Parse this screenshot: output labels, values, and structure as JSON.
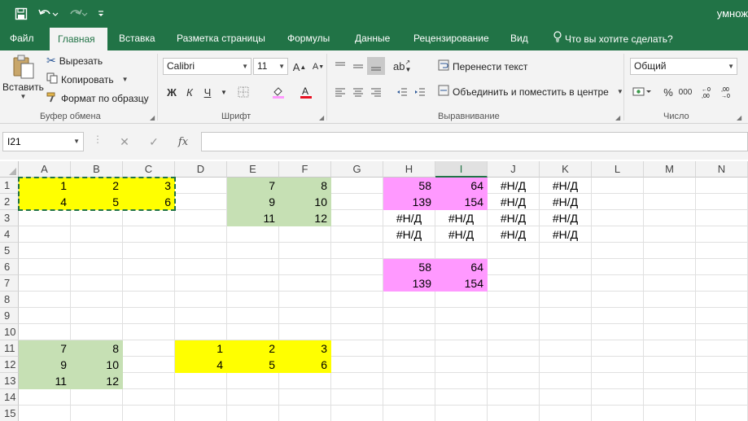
{
  "colors": {
    "accent": "#217346",
    "yellow": "#ffff00",
    "green_fill": "#c6e0b4",
    "pink_fill": "#ff99ff"
  },
  "titlebar": {
    "doc_title": "умнож",
    "icons": [
      "save-icon",
      "undo-icon",
      "redo-icon",
      "customize-qat-icon"
    ]
  },
  "tabs": [
    "Файл",
    "Главная",
    "Вставка",
    "Разметка страницы",
    "Формулы",
    "Данные",
    "Рецензирование",
    "Вид"
  ],
  "active_tab": "Главная",
  "tell_me": "Что вы хотите сделать?",
  "clipboard": {
    "paste": "Вставить",
    "cut": "Вырезать",
    "copy": "Копировать",
    "format_painter": "Формат по образцу",
    "group": "Буфер обмена"
  },
  "font": {
    "name": "Calibri",
    "size": "11",
    "bold": "Ж",
    "italic": "К",
    "underline": "Ч",
    "group": "Шрифт"
  },
  "alignment": {
    "wrap": "Перенести текст",
    "merge": "Объединить и поместить в центре",
    "group": "Выравнивание"
  },
  "number": {
    "format": "Общий",
    "percent": "%",
    "thousands": "000",
    "group": "Число"
  },
  "formula_bar": {
    "name_box": "I21",
    "fx": "fx",
    "value": ""
  },
  "sheet": {
    "columns": [
      "A",
      "B",
      "C",
      "D",
      "E",
      "F",
      "G",
      "H",
      "I",
      "J",
      "K",
      "L",
      "M",
      "N"
    ],
    "selected_column": "I",
    "rows": [
      "1",
      "2",
      "3",
      "4",
      "5",
      "6",
      "7",
      "8",
      "9",
      "10",
      "11",
      "12",
      "13",
      "14",
      "15"
    ],
    "cells": [
      {
        "ref": "A1",
        "value": "1",
        "fill": "yellow"
      },
      {
        "ref": "B1",
        "value": "2",
        "fill": "yellow"
      },
      {
        "ref": "C1",
        "value": "3",
        "fill": "yellow"
      },
      {
        "ref": "A2",
        "value": "4",
        "fill": "yellow"
      },
      {
        "ref": "B2",
        "value": "5",
        "fill": "yellow"
      },
      {
        "ref": "C2",
        "value": "6",
        "fill": "yellow"
      },
      {
        "ref": "E1",
        "value": "7",
        "fill": "green"
      },
      {
        "ref": "F1",
        "value": "8",
        "fill": "green"
      },
      {
        "ref": "E2",
        "value": "9",
        "fill": "green"
      },
      {
        "ref": "F2",
        "value": "10",
        "fill": "green"
      },
      {
        "ref": "E3",
        "value": "11",
        "fill": "green"
      },
      {
        "ref": "F3",
        "value": "12",
        "fill": "green"
      },
      {
        "ref": "H1",
        "value": "58",
        "fill": "pink"
      },
      {
        "ref": "I1",
        "value": "64",
        "fill": "pink"
      },
      {
        "ref": "H2",
        "value": "139",
        "fill": "pink"
      },
      {
        "ref": "I2",
        "value": "154",
        "fill": "pink"
      },
      {
        "ref": "J1",
        "value": "#Н/Д",
        "align": "center"
      },
      {
        "ref": "K1",
        "value": "#Н/Д",
        "align": "center"
      },
      {
        "ref": "J2",
        "value": "#Н/Д",
        "align": "center"
      },
      {
        "ref": "K2",
        "value": "#Н/Д",
        "align": "center"
      },
      {
        "ref": "H3",
        "value": "#Н/Д",
        "align": "center"
      },
      {
        "ref": "I3",
        "value": "#Н/Д",
        "align": "center"
      },
      {
        "ref": "J3",
        "value": "#Н/Д",
        "align": "center"
      },
      {
        "ref": "K3",
        "value": "#Н/Д",
        "align": "center"
      },
      {
        "ref": "H4",
        "value": "#Н/Д",
        "align": "center"
      },
      {
        "ref": "I4",
        "value": "#Н/Д",
        "align": "center"
      },
      {
        "ref": "J4",
        "value": "#Н/Д",
        "align": "center"
      },
      {
        "ref": "K4",
        "value": "#Н/Д",
        "align": "center"
      },
      {
        "ref": "H6",
        "value": "58",
        "fill": "pink"
      },
      {
        "ref": "I6",
        "value": "64",
        "fill": "pink"
      },
      {
        "ref": "H7",
        "value": "139",
        "fill": "pink"
      },
      {
        "ref": "I7",
        "value": "154",
        "fill": "pink"
      },
      {
        "ref": "A11",
        "value": "7",
        "fill": "green"
      },
      {
        "ref": "B11",
        "value": "8",
        "fill": "green"
      },
      {
        "ref": "A12",
        "value": "9",
        "fill": "green"
      },
      {
        "ref": "B12",
        "value": "10",
        "fill": "green"
      },
      {
        "ref": "A13",
        "value": "11",
        "fill": "green"
      },
      {
        "ref": "B13",
        "value": "12",
        "fill": "green"
      },
      {
        "ref": "D11",
        "value": "1",
        "fill": "yellow"
      },
      {
        "ref": "E11",
        "value": "2",
        "fill": "yellow"
      },
      {
        "ref": "F11",
        "value": "3",
        "fill": "yellow"
      },
      {
        "ref": "D12",
        "value": "4",
        "fill": "yellow"
      },
      {
        "ref": "E12",
        "value": "5",
        "fill": "yellow"
      },
      {
        "ref": "F12",
        "value": "6",
        "fill": "yellow"
      }
    ]
  }
}
